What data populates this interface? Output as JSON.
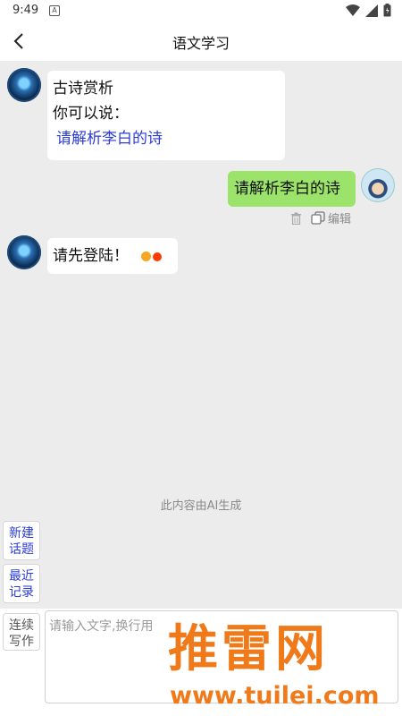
{
  "status": {
    "time": "9:49",
    "notification_glyph": "A"
  },
  "header": {
    "title": "语文学习"
  },
  "messages": {
    "ai_1": {
      "heading": "古诗赏析",
      "hint": "你可以说：",
      "suggestion": "请解析李白的诗"
    },
    "user_1": {
      "text": "请解析李白的诗",
      "edit_label": "编辑"
    },
    "ai_2": {
      "text": "请先登陆！"
    }
  },
  "notice": "此内容由AI生成",
  "side_buttons": {
    "new_topic": "新建\n话题",
    "recent": "最近\n记录",
    "continuous": "连续\n写作"
  },
  "input": {
    "placeholder": "请输入文字,换行用"
  },
  "watermark": {
    "brand": "推雷网",
    "url": "www.tuilei.com"
  },
  "colors": {
    "user_bubble": "#9be36a",
    "link": "#2b3cd6",
    "loading_dots": [
      "#f5a623",
      "#ff3b00"
    ]
  }
}
